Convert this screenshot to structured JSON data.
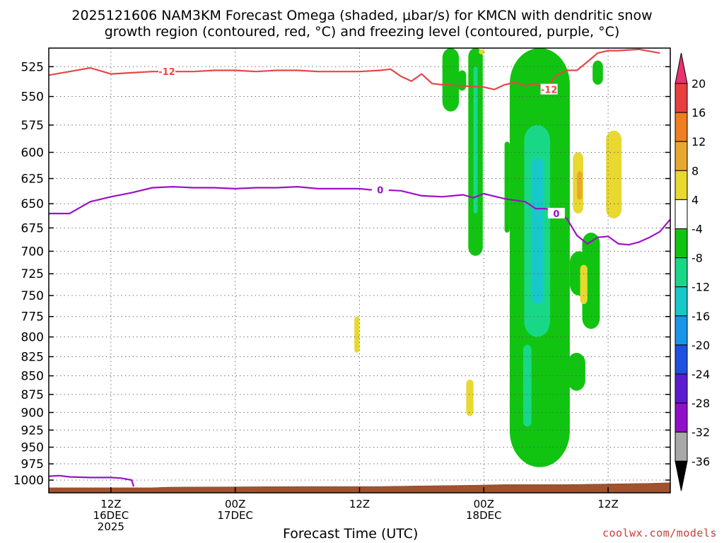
{
  "title_line1": "2025121606 NAM3KM Forecast Omega (shaded, μbar/s) for KMCN with dendritic snow",
  "title_line2": "growth region (contoured, red, °C) and freezing level (contoured, purple, °C)",
  "credit": "coolwx.com/models",
  "chart_data": {
    "type": "heatmap",
    "xlabel": "Forecast Time (UTC)",
    "x_axis": {
      "units": "hours since 2025-12-16 06Z",
      "range": [
        0,
        60
      ],
      "ticks": [
        {
          "hour": 6,
          "label": [
            "12Z",
            "16DEC",
            "2025"
          ]
        },
        {
          "hour": 18,
          "label": [
            "00Z",
            "17DEC"
          ]
        },
        {
          "hour": 30,
          "label": [
            "12Z"
          ]
        },
        {
          "hour": 42,
          "label": [
            "00Z",
            "18DEC"
          ]
        },
        {
          "hour": 54,
          "label": [
            "12Z"
          ]
        }
      ]
    },
    "y_axis": {
      "units": "hPa",
      "range": [
        1020,
        510
      ],
      "ticks": [
        "525",
        "550",
        "575",
        "600",
        "625",
        "650",
        "675",
        "700",
        "725",
        "750",
        "775",
        "800",
        "825",
        "850",
        "875",
        "900",
        "925",
        "950",
        "975",
        "1000"
      ]
    },
    "colorbar": {
      "labels": [
        "20",
        "16",
        "12",
        "8",
        "4",
        "-4",
        "-8",
        "-12",
        "-16",
        "-20",
        "-24",
        "-28",
        "-32",
        "-36"
      ],
      "colors": [
        "#e8336e",
        "#e84040",
        "#ef7d22",
        "#e8a830",
        "#e8d830",
        "#ffffff",
        "#11c411",
        "#18d888",
        "#18c8c8",
        "#1a96e8",
        "#2050e0",
        "#5c1cd0",
        "#9010c8",
        "#a8a8a8",
        "#000000"
      ]
    },
    "grid": true,
    "series": [
      {
        "kind": "contour",
        "contour_label": "-12",
        "color": "#e84646",
        "points": [
          [
            0,
            532
          ],
          [
            2,
            529
          ],
          [
            4,
            526
          ],
          [
            6,
            531
          ],
          [
            8,
            530
          ],
          [
            10,
            529
          ],
          [
            12,
            529
          ],
          [
            14,
            529
          ],
          [
            16,
            528
          ],
          [
            18,
            528
          ],
          [
            20,
            529
          ],
          [
            22,
            528
          ],
          [
            24,
            528
          ],
          [
            26,
            529
          ],
          [
            28,
            529
          ],
          [
            30,
            529
          ],
          [
            32,
            528
          ],
          [
            33,
            527
          ],
          [
            34,
            533
          ],
          [
            35,
            537
          ],
          [
            36,
            531
          ],
          [
            37,
            539
          ],
          [
            38,
            540
          ],
          [
            40,
            541
          ],
          [
            42,
            542
          ],
          [
            43,
            544
          ],
          [
            44,
            540
          ],
          [
            45,
            538
          ],
          [
            46,
            541
          ],
          [
            47,
            539
          ],
          [
            48,
            544
          ],
          [
            49,
            532
          ],
          [
            50,
            528
          ],
          [
            51,
            528
          ],
          [
            52,
            521
          ],
          [
            53,
            514
          ],
          [
            54,
            512
          ],
          [
            55,
            512
          ],
          [
            57,
            511
          ],
          [
            59,
            514
          ]
        ]
      },
      {
        "kind": "contour",
        "contour_label": "0",
        "color": "#9a12c8",
        "points": [
          [
            0,
            660
          ],
          [
            2,
            660
          ],
          [
            4,
            648
          ],
          [
            6,
            643
          ],
          [
            8,
            639
          ],
          [
            10,
            634
          ],
          [
            12,
            633
          ],
          [
            14,
            634
          ],
          [
            16,
            634
          ],
          [
            18,
            635
          ],
          [
            20,
            634
          ],
          [
            22,
            634
          ],
          [
            24,
            633
          ],
          [
            26,
            635
          ],
          [
            28,
            635
          ],
          [
            30,
            635
          ],
          [
            31,
            636
          ],
          [
            32,
            636
          ],
          [
            34,
            637
          ],
          [
            36,
            642
          ],
          [
            38,
            643
          ],
          [
            40,
            641
          ],
          [
            41,
            644
          ],
          [
            42,
            640
          ],
          [
            44,
            645
          ],
          [
            46,
            648
          ],
          [
            47,
            655
          ],
          [
            48,
            655
          ],
          [
            49,
            660
          ],
          [
            50,
            665
          ],
          [
            51,
            683
          ],
          [
            52,
            692
          ],
          [
            53,
            685
          ],
          [
            54,
            684
          ],
          [
            55,
            692
          ],
          [
            56,
            693
          ],
          [
            57,
            690
          ],
          [
            58,
            685
          ],
          [
            59,
            679
          ],
          [
            60,
            666
          ]
        ]
      },
      {
        "kind": "contour",
        "contour_label": "0",
        "color": "#9a12c8",
        "points": [
          [
            0,
            994
          ],
          [
            1,
            993
          ],
          [
            2,
            995
          ],
          [
            4,
            996
          ],
          [
            6,
            996
          ],
          [
            7,
            997
          ],
          [
            8,
            1000
          ],
          [
            8.2,
            1010
          ]
        ]
      }
    ],
    "omega_regions": [
      {
        "value": -6,
        "t": [
          38.0,
          39.6
        ],
        "p": [
          510,
          563
        ]
      },
      {
        "value": -6,
        "t": [
          39.5,
          40.3
        ],
        "p": [
          528,
          545
        ]
      },
      {
        "value": -6,
        "t": [
          40.5,
          41.9
        ],
        "p": [
          510,
          705
        ]
      },
      {
        "value": -10,
        "t": [
          41.0,
          41.4
        ],
        "p": [
          525,
          660
        ]
      },
      {
        "value": -6,
        "t": [
          44.0,
          44.5
        ],
        "p": [
          590,
          680
        ]
      },
      {
        "value": -6,
        "t": [
          44.5,
          50.3
        ],
        "p": [
          510,
          980
        ]
      },
      {
        "value": -10,
        "t": [
          45.9,
          48.4
        ],
        "p": [
          575,
          800
        ]
      },
      {
        "value": -14,
        "t": [
          46.6,
          47.8
        ],
        "p": [
          605,
          760
        ]
      },
      {
        "value": -6,
        "t": [
          50.3,
          52.1
        ],
        "p": [
          700,
          750
        ]
      },
      {
        "value": -6,
        "t": [
          50.1,
          51.8
        ],
        "p": [
          820,
          870
        ]
      },
      {
        "value": -6,
        "t": [
          51.5,
          53.2
        ],
        "p": [
          680,
          790
        ]
      },
      {
        "value": -6,
        "t": [
          52.5,
          53.5
        ],
        "p": [
          520,
          540
        ]
      },
      {
        "value": -10,
        "t": [
          45.8,
          46.6
        ],
        "p": [
          810,
          920
        ]
      },
      {
        "value": 6,
        "t": [
          50.6,
          51.6
        ],
        "p": [
          600,
          660
        ]
      },
      {
        "value": 10,
        "t": [
          51.0,
          51.5
        ],
        "p": [
          618,
          646
        ]
      },
      {
        "value": 6,
        "t": [
          51.3,
          52.0
        ],
        "p": [
          715,
          760
        ]
      },
      {
        "value": 6,
        "t": [
          53.8,
          55.3
        ],
        "p": [
          580,
          665
        ]
      },
      {
        "value": 6,
        "t": [
          29.5,
          30.0
        ],
        "p": [
          775,
          820
        ]
      },
      {
        "value": 6,
        "t": [
          40.3,
          41.0
        ],
        "p": [
          855,
          905
        ]
      },
      {
        "value": 6,
        "t": [
          41.5,
          42.1
        ],
        "p": [
          511,
          515
        ]
      }
    ],
    "terrain": [
      [
        0,
        1012
      ],
      [
        10,
        1012
      ],
      [
        11.5,
        1011
      ],
      [
        25,
        1010
      ],
      [
        32,
        1010
      ],
      [
        36,
        1009
      ],
      [
        41,
        1008
      ],
      [
        44,
        1007
      ],
      [
        50,
        1007
      ],
      [
        58,
        1005
      ],
      [
        60,
        1004
      ]
    ]
  }
}
